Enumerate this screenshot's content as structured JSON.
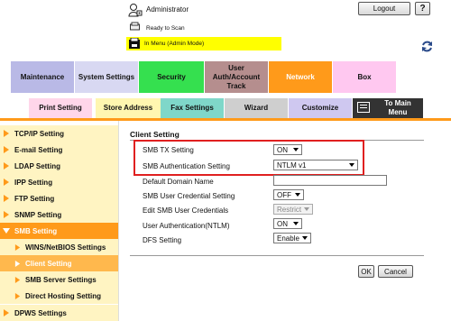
{
  "header": {
    "user_label": "Administrator",
    "logout_label": "Logout",
    "help_label": "?",
    "status_label": "Ready to Scan",
    "mode_label": "In Menu (Admin Mode)"
  },
  "tabs_row1": [
    {
      "label": "Maintenance",
      "color": "#b9b9e6"
    },
    {
      "label": "System Settings",
      "color": "#d8d8f2"
    },
    {
      "label": "Security",
      "color": "#35e04f"
    },
    {
      "label": "User Auth/Account Track",
      "color": "#b58e8e"
    },
    {
      "label": "Network",
      "color": "#ff9a1a"
    },
    {
      "label": "Box",
      "color": "#ffc8f0"
    }
  ],
  "tabs_row2": [
    {
      "label": "Print Setting",
      "color": "#ffd6ea"
    },
    {
      "label": "Store Address",
      "color": "#fff6b0"
    },
    {
      "label": "Fax Settings",
      "color": "#7fd7c9"
    },
    {
      "label": "Wizard",
      "color": "#cfcfcf"
    },
    {
      "label": "Customize",
      "color": "#cfc8f0"
    },
    {
      "label": "To Main Menu",
      "color": "#333333"
    }
  ],
  "sidebar": {
    "items": [
      {
        "label": "TCP/IP Setting",
        "bg": "#fff4c2",
        "sub": false
      },
      {
        "label": "E-mail Setting",
        "bg": "#fff4c2",
        "sub": false
      },
      {
        "label": "LDAP Setting",
        "bg": "#fff4c2",
        "sub": false
      },
      {
        "label": "IPP Setting",
        "bg": "#fff4c2",
        "sub": false
      },
      {
        "label": "FTP Setting",
        "bg": "#fff4c2",
        "sub": false
      },
      {
        "label": "SNMP Setting",
        "bg": "#fff4c2",
        "sub": false
      },
      {
        "label": "SMB Setting",
        "bg": "#ff9a1a",
        "sub": false,
        "active": true
      },
      {
        "label": "WINS/NetBIOS Settings",
        "bg": "#fff4c2",
        "sub": true
      },
      {
        "label": "Client Setting",
        "bg": "#ffb84d",
        "sub": true,
        "active": true
      },
      {
        "label": "SMB Server Settings",
        "bg": "#fff4c2",
        "sub": true
      },
      {
        "label": "Direct Hosting Setting",
        "bg": "#fff4c2",
        "sub": true
      },
      {
        "label": "DPWS Settings",
        "bg": "#fff4c2",
        "sub": false
      }
    ]
  },
  "content": {
    "title": "Client Setting",
    "rows": [
      {
        "label": "SMB TX Setting",
        "type": "select",
        "value": "ON"
      },
      {
        "label": "SMB Authentication Setting",
        "type": "select",
        "value": "NTLM v1"
      },
      {
        "label": "Default Domain Name",
        "type": "text",
        "value": ""
      },
      {
        "label": "SMB User Credential Setting",
        "type": "select",
        "value": "OFF"
      },
      {
        "label": "Edit SMB User Credentials",
        "type": "select-disabled",
        "value": "Restrict"
      },
      {
        "label": "User Authentication(NTLM)",
        "type": "select",
        "value": "ON"
      },
      {
        "label": "DFS Setting",
        "type": "select",
        "value": "Enable"
      }
    ],
    "ok_label": "OK",
    "cancel_label": "Cancel"
  },
  "colors": {
    "accent": "#ff9a1a",
    "highlight": "#e02020",
    "mode_bar": "#ffff00"
  }
}
